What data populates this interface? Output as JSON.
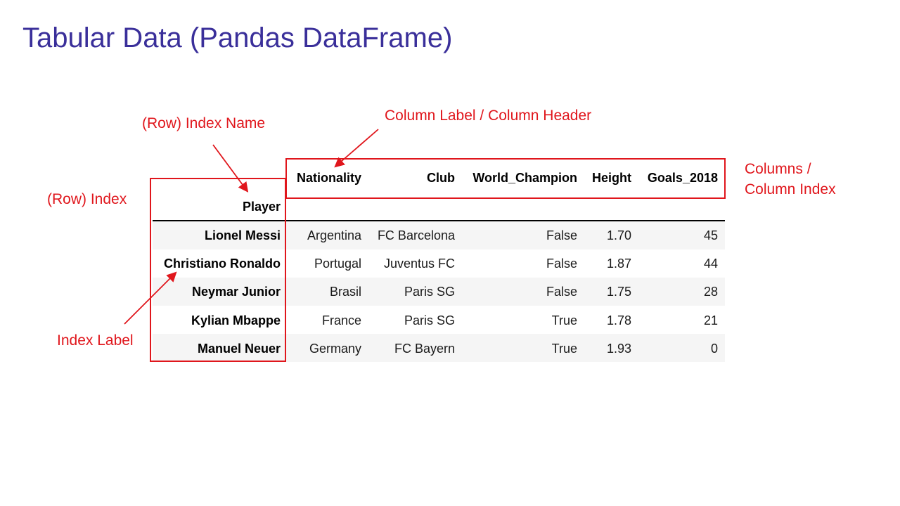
{
  "slide": {
    "title": "Tabular Data (Pandas DataFrame)"
  },
  "annotations": {
    "row_index_name": "(Row) Index Name",
    "column_label": "Column Label / Column Header",
    "columns_line1": "Columns /",
    "columns_line2": "Column Index",
    "row_index": "(Row) Index",
    "index_label": "Index Label"
  },
  "dataframe": {
    "columns": [
      "Nationality",
      "Club",
      "World_Champion",
      "Height",
      "Goals_2018"
    ],
    "index_name": "Player",
    "index": [
      "Lionel Messi",
      "Christiano Ronaldo",
      "Neymar Junior",
      "Kylian Mbappe",
      "Manuel Neuer"
    ],
    "rows": [
      [
        "Argentina",
        "FC Barcelona",
        "False",
        "1.70",
        "45"
      ],
      [
        "Portugal",
        "Juventus FC",
        "False",
        "1.87",
        "44"
      ],
      [
        "Brasil",
        "Paris SG",
        "False",
        "1.75",
        "28"
      ],
      [
        "France",
        "Paris SG",
        "True",
        "1.78",
        "21"
      ],
      [
        "Germany",
        "FC Bayern",
        "True",
        "1.93",
        "0"
      ]
    ]
  },
  "colors": {
    "title": "#3a2f9a",
    "annotation": "#e0161c",
    "stripe": "#f5f5f5"
  }
}
